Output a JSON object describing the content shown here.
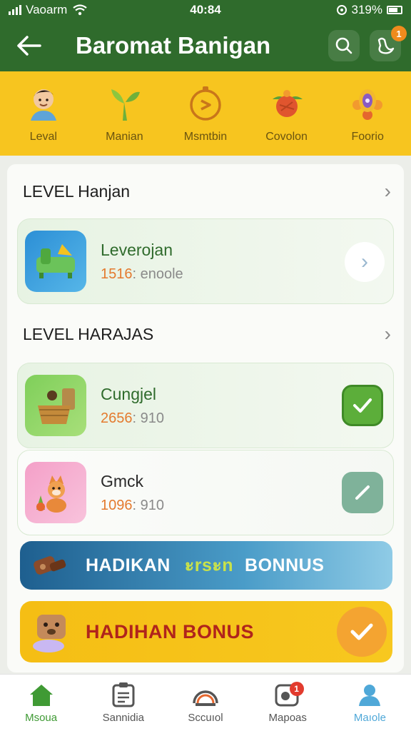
{
  "status_bar": {
    "carrier": "Vaoarm",
    "time": "40:84",
    "battery": "319%"
  },
  "header": {
    "title": "Baromat Banigan",
    "notification_count": "1"
  },
  "categories": [
    {
      "label": "Leval",
      "icon": "boy-avatar-icon"
    },
    {
      "label": "Manian",
      "icon": "plant-sprout-icon"
    },
    {
      "label": "Msmtbin",
      "icon": "timer-dial-icon"
    },
    {
      "label": "Covolon",
      "icon": "flower-basket-icon"
    },
    {
      "label": "Foorio",
      "icon": "sun-flower-icon"
    }
  ],
  "sections": [
    {
      "title": "LEVEL Hanjan",
      "items": [
        {
          "title": "Leverojan",
          "meta_number": "1516",
          "meta_rest": ": enoole",
          "action": "chevron"
        }
      ]
    },
    {
      "title": "LEVEL HARAJAS",
      "items": [
        {
          "title": "Cungjel",
          "meta_number": "2656",
          "meta_rest": ": 910",
          "action": "check"
        },
        {
          "title": "Gmck",
          "meta_number": "1096",
          "meta_rest": ": 910",
          "action": "edit"
        }
      ]
    }
  ],
  "banners": {
    "blue": {
      "part1": "HADIKAN",
      "part2": "ะrsะn",
      "part3": "BONNUS"
    },
    "yellow": {
      "text": "HADIHAN BONUS"
    }
  },
  "bottom_nav": [
    {
      "label": "Msoua",
      "icon": "home-icon"
    },
    {
      "label": "Sannidia",
      "icon": "clipboard-icon"
    },
    {
      "label": "Sccuıol",
      "icon": "gauge-icon"
    },
    {
      "label": "Mapoas",
      "icon": "map-badge-icon",
      "badge": "1"
    },
    {
      "label": "Maıole",
      "icon": "profile-icon"
    }
  ],
  "colors": {
    "header_green": "#2f6b2c",
    "strip_yellow": "#f7c51f",
    "accent_orange": "#e47a2e",
    "active_nav": "#4fa8d8"
  }
}
